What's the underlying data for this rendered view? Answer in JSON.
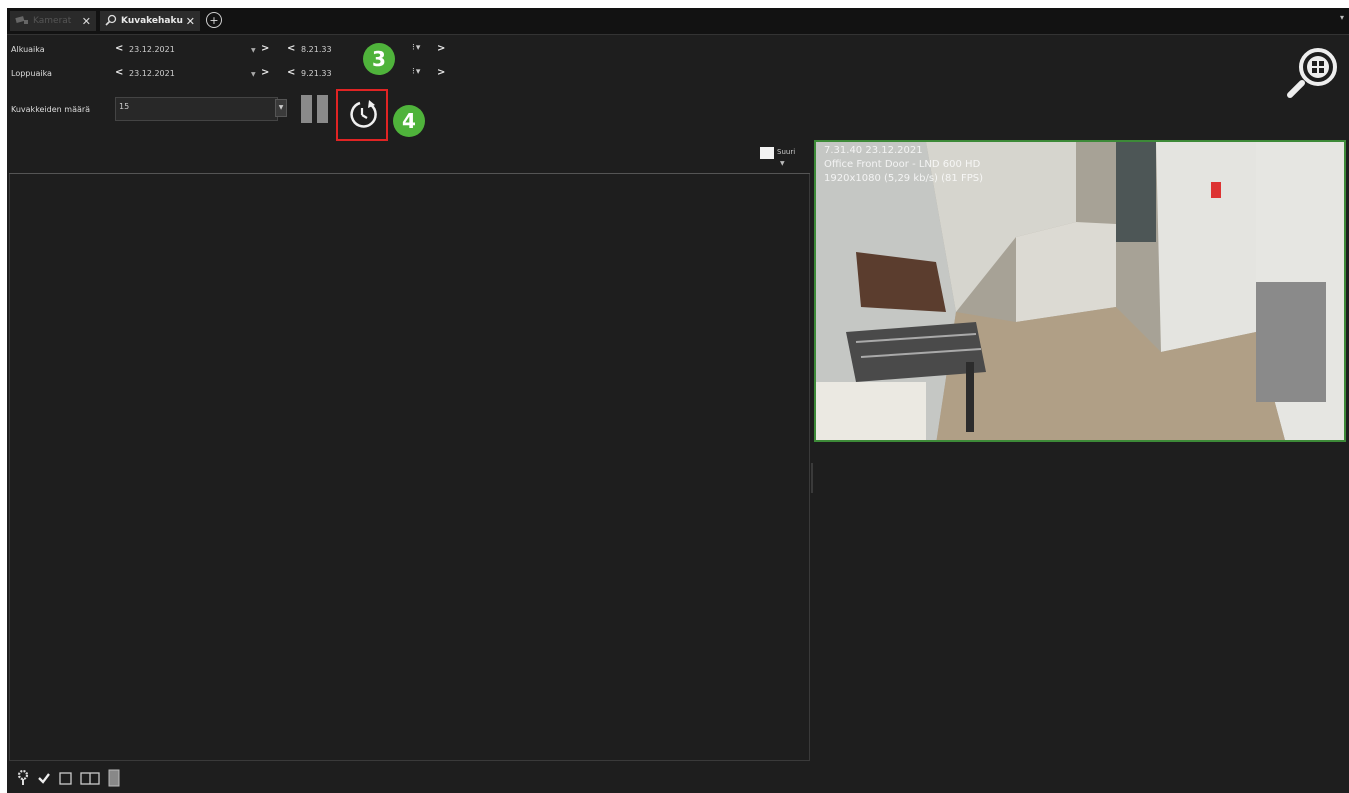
{
  "tabs": [
    {
      "label": "Kamerat",
      "icon": "camera-icon",
      "active": false
    },
    {
      "label": "Kuvakehaku",
      "icon": "magnifier-icon",
      "active": true
    }
  ],
  "time_range": {
    "start": {
      "label": "Alkuaika",
      "date": "23.12.2021",
      "time": "8.21.33"
    },
    "end": {
      "label": "Loppuaika",
      "date": "23.12.2021",
      "time": "9.21.33"
    }
  },
  "image_count": {
    "label": "Kuvakkeiden määrä",
    "value": "15"
  },
  "annotations": {
    "step_time": "3",
    "step_search": "4",
    "highlight_color": "#e02424",
    "badge_color": "#4fb33b"
  },
  "large_option": {
    "label": "Suuri"
  },
  "preview": {
    "overlay": [
      "7.31.40 23.12.2021",
      "Office Front Door - LND 600 HD",
      "1920x1080 (5,29 kb/s) (81 FPS)"
    ],
    "border_color": "#3d8a38"
  },
  "bottom_icons": [
    "gear-icon",
    "check-icon",
    "single-view-icon",
    "split-view-icon",
    "column-view-icon"
  ]
}
